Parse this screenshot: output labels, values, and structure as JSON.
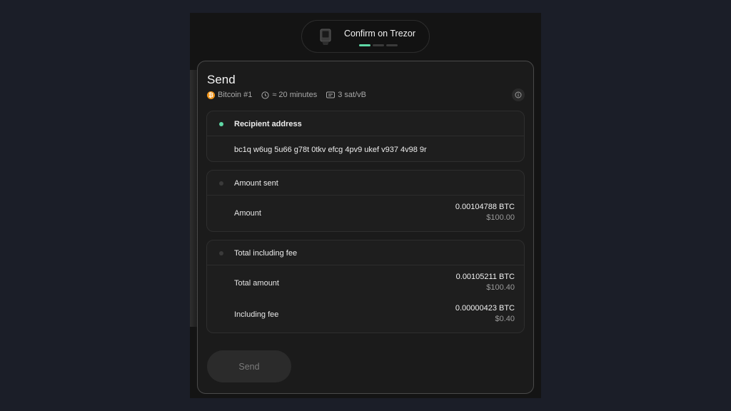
{
  "header": {
    "confirm_label": "Confirm on Trezor",
    "progress_steps": 3,
    "progress_active": 1,
    "accent_color": "#5fd9a6"
  },
  "card": {
    "title": "Send",
    "meta": {
      "account": "Bitcoin #1",
      "coin_icon": "bitcoin-icon",
      "time": "≈ 20 minutes",
      "time_icon": "clock-icon",
      "fee_rate": "3 sat/vB",
      "fee_icon": "fee-icon",
      "info_icon": "info-icon"
    },
    "recipient": {
      "title": "Recipient address",
      "address": "bc1q w6ug 5u66 g78t 0tkv efcg 4pv9 ukef v937 4v98 9r"
    },
    "amount_sent": {
      "title": "Amount sent",
      "label": "Amount",
      "btc": "0.00104788 BTC",
      "fiat": "$100.00"
    },
    "total": {
      "title": "Total including fee",
      "total_label": "Total amount",
      "total_btc": "0.00105211 BTC",
      "total_fiat": "$100.40",
      "fee_label": "Including fee",
      "fee_btc": "0.00000423 BTC",
      "fee_fiat": "$0.40"
    },
    "send_label": "Send"
  }
}
